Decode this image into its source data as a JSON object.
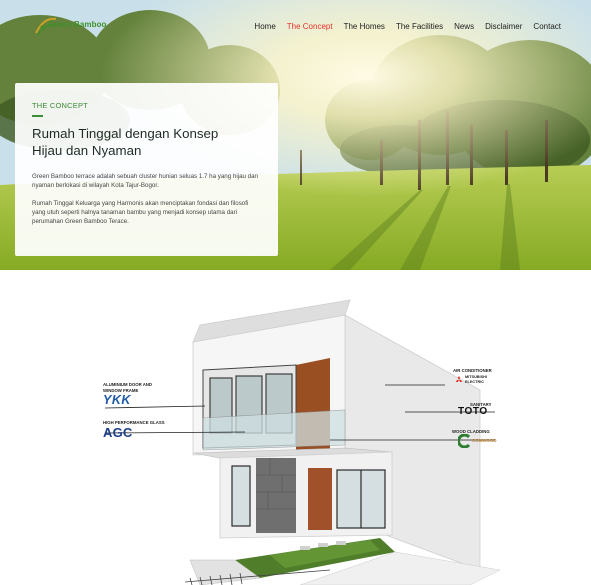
{
  "site": {
    "logo_text": "Green Bamboo"
  },
  "nav": {
    "items": [
      {
        "label": "Home"
      },
      {
        "label": "The Concept"
      },
      {
        "label": "The Homes"
      },
      {
        "label": "The Facilities"
      },
      {
        "label": "News"
      },
      {
        "label": "Disclaimer"
      },
      {
        "label": "Contact"
      }
    ],
    "active_index": 1
  },
  "concept": {
    "eyebrow": "THE CONCEPT",
    "title_line1": "Rumah Tinggal dengan Konsep",
    "title_line2": "Hijau dan Nyaman",
    "paragraph1": "Green Bamboo terrace adalah sebuah cluster hunian seluas 1.7 ha yang hijau dan nyaman berlokasi di wilayah Kota Tajur-Bogor.",
    "paragraph2": "Rumah Tinggal Keluarga yang Harmonis akan menciptakan fondasi dan filosofi yang utuh seperti halnya tanaman bambu yang menjadi konsep utama dari perumahan Green Bamboo Terace."
  },
  "illustration": {
    "labels": {
      "aluminium_line1": "ALUMINIUM DOOR AND",
      "aluminium_line2": "WINDOW FRAME",
      "ykk": "YKK",
      "glass": "HIGH PERFORMANCE GLASS",
      "agc": "AGC",
      "aircon": "AIR CONDITIONER",
      "mitsu_line1": "MITSUBISHI",
      "mitsu_line2": "ELECTRIC",
      "sanitary": "SANITARY",
      "toto": "TOTO",
      "wood": "WOOD CLADDING",
      "conwood": "CONWOOD"
    }
  },
  "colors": {
    "accent_green": "#3c8c37",
    "active_nav": "#e4312b",
    "ykk_blue": "#1e5aa8",
    "agc_blue": "#1c3f8a"
  }
}
